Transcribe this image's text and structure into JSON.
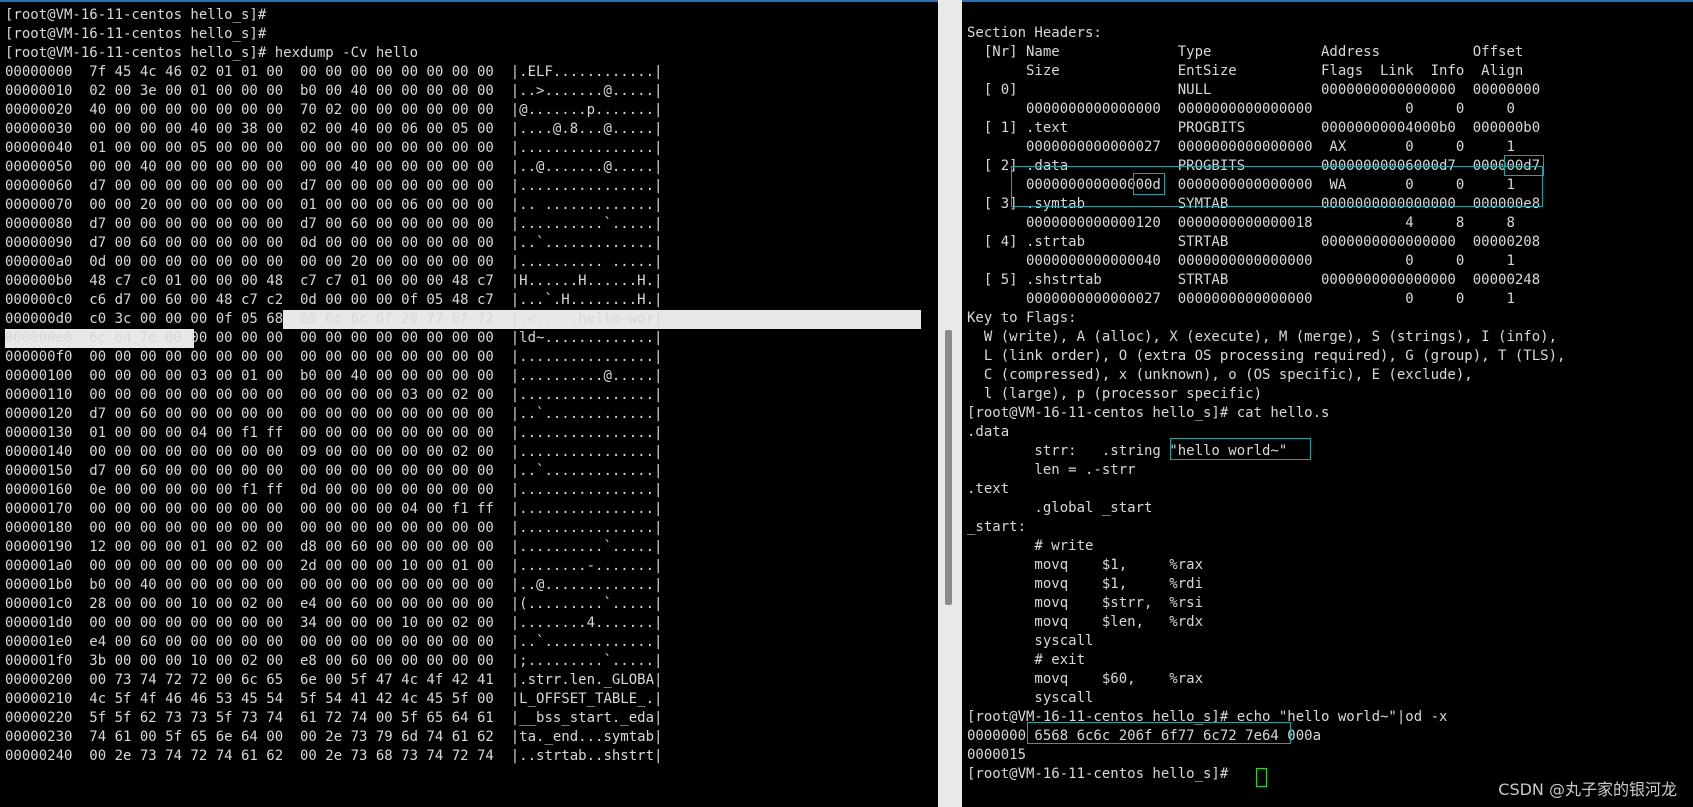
{
  "left_terminal": {
    "lines": [
      "[root@VM-16-11-centos hello_s]#",
      "[root@VM-16-11-centos hello_s]#",
      "[root@VM-16-11-centos hello_s]# hexdump -Cv hello",
      "00000000  7f 45 4c 46 02 01 01 00  00 00 00 00 00 00 00 00  |.ELF............|",
      "00000010  02 00 3e 00 01 00 00 00  b0 00 40 00 00 00 00 00  |..>.......@.....|",
      "00000020  40 00 00 00 00 00 00 00  70 02 00 00 00 00 00 00  |@.......p.......|",
      "00000030  00 00 00 00 40 00 38 00  02 00 40 00 06 00 05 00  |....@.8...@.....|",
      "00000040  01 00 00 00 05 00 00 00  00 00 00 00 00 00 00 00  |................|",
      "00000050  00 00 40 00 00 00 00 00  00 00 40 00 00 00 00 00  |..@.......@.....|",
      "00000060  d7 00 00 00 00 00 00 00  d7 00 00 00 00 00 00 00  |................|",
      "00000070  00 00 20 00 00 00 00 00  01 00 00 00 06 00 00 00  |.. .............|",
      "00000080  d7 00 00 00 00 00 00 00  d7 00 60 00 00 00 00 00  |..........`.....|",
      "00000090  d7 00 60 00 00 00 00 00  0d 00 00 00 00 00 00 00  |..`.............|",
      "000000a0  0d 00 00 00 00 00 00 00  00 00 20 00 00 00 00 00  |.......... .....|",
      "000000b0  48 c7 c0 01 00 00 00 48  c7 c7 01 00 00 00 48 c7  |H......H......H.|",
      "000000c0  c6 d7 00 60 00 48 c7 c2  0d 00 00 00 0f 05 48 c7  |...`.H........H.|",
      "000000d0  c0 3c 00 00 00 0f 05 68  65 6c 6c 6f 20 77 6f 72  |.<.....hello wor|",
      "000000e0  6c 64 7e 00 00 00 00 00  00 00 00 00 00 00 00 00  |ld~.............|",
      "000000f0  00 00 00 00 00 00 00 00  00 00 00 00 00 00 00 00  |................|",
      "00000100  00 00 00 00 03 00 01 00  b0 00 40 00 00 00 00 00  |..........@.....|",
      "00000110  00 00 00 00 00 00 00 00  00 00 00 00 03 00 02 00  |................|",
      "00000120  d7 00 60 00 00 00 00 00  00 00 00 00 00 00 00 00  |..`.............|",
      "00000130  01 00 00 00 04 00 f1 ff  00 00 00 00 00 00 00 00  |................|",
      "00000140  00 00 00 00 00 00 00 00  09 00 00 00 00 00 02 00  |................|",
      "00000150  d7 00 60 00 00 00 00 00  00 00 00 00 00 00 00 00  |..`.............|",
      "00000160  0e 00 00 00 00 00 f1 ff  0d 00 00 00 00 00 00 00  |................|",
      "00000170  00 00 00 00 00 00 00 00  00 00 00 00 04 00 f1 ff  |................|",
      "00000180  00 00 00 00 00 00 00 00  00 00 00 00 00 00 00 00  |................|",
      "00000190  12 00 00 00 01 00 02 00  d8 00 60 00 00 00 00 00  |..........`.....|",
      "000001a0  00 00 00 00 00 00 00 00  2d 00 00 00 10 00 01 00  |........-.......|",
      "000001b0  b0 00 40 00 00 00 00 00  00 00 00 00 00 00 00 00  |..@.............|",
      "000001c0  28 00 00 00 10 00 02 00  e4 00 60 00 00 00 00 00  |(.........`.....|",
      "000001d0  00 00 00 00 00 00 00 00  34 00 00 00 10 00 02 00  |........4.......|",
      "000001e0  e4 00 60 00 00 00 00 00  00 00 00 00 00 00 00 00  |..`.............|",
      "000001f0  3b 00 00 00 10 00 02 00  e8 00 60 00 00 00 00 00  |;.........`.....|",
      "00000200  00 73 74 72 72 00 6c 65  6e 00 5f 47 4c 4f 42 41  |.strr.len._GLOBA|",
      "00000210  4c 5f 4f 46 46 53 45 54  5f 54 41 42 4c 45 5f 00  |L_OFFSET_TABLE_.|",
      "00000220  5f 5f 62 73 73 5f 73 74  61 72 74 00 5f 65 64 61  |__bss_start._eda|",
      "00000230  74 61 00 5f 65 6e 64 00  00 2e 73 79 6d 74 61 62  |ta._end...symtab|",
      "00000240  00 2e 73 74 72 74 61 62  00 2e 73 68 73 74 72 74  |..strtab..shstrt|"
    ]
  },
  "right_terminal": {
    "lines": [
      "Section Headers:",
      "  [Nr] Name              Type             Address           Offset",
      "       Size              EntSize          Flags  Link  Info  Align",
      "  [ 0]                   NULL             0000000000000000  00000000",
      "       0000000000000000  0000000000000000           0     0     0",
      "  [ 1] .text             PROGBITS         00000000004000b0  000000b0",
      "       0000000000000027  0000000000000000  AX       0     0     1",
      "  [ 2] .data             PROGBITS         00000000006000d7  000000d7",
      "       000000000000000d  0000000000000000  WA       0     0     1",
      "  [ 3] .symtab           SYMTAB           0000000000000000  000000e8",
      "       0000000000000120  0000000000000018           4     8     8",
      "  [ 4] .strtab           STRTAB           0000000000000000  00000208",
      "       0000000000000040  0000000000000000           0     0     1",
      "  [ 5] .shstrtab         STRTAB           0000000000000000  00000248",
      "       0000000000000027  0000000000000000           0     0     1",
      "Key to Flags:",
      "  W (write), A (alloc), X (execute), M (merge), S (strings), I (info),",
      "  L (link order), O (extra OS processing required), G (group), T (TLS),",
      "  C (compressed), x (unknown), o (OS specific), E (exclude),",
      "  l (large), p (processor specific)",
      "[root@VM-16-11-centos hello_s]# cat hello.s",
      ".data",
      "        strr:   .string \"hello world~\"",
      "        len = .-strr",
      ".text",
      "        .global _start",
      "_start:",
      "        # write",
      "        movq    $1,     %rax",
      "        movq    $1,     %rdi",
      "        movq    $strr,  %rsi",
      "        movq    $len,   %rdx",
      "        syscall",
      "        # exit",
      "        movq    $60,    %rax",
      "        syscall",
      "[root@VM-16-11-centos hello_s]# echo \"hello world~\"|od -x",
      "0000000 6568 6c6c 206f 6f77 6c72 7e64 000a",
      "0000015",
      "[root@VM-16-11-centos hello_s]# "
    ]
  },
  "watermark": "CSDN @丸子家的银河龙",
  "colors": {
    "background": "#000000",
    "text": "#d8d8d8",
    "highlight": "#e8e8e8",
    "box": "#1aa4a8",
    "cursor": "#19e019"
  }
}
